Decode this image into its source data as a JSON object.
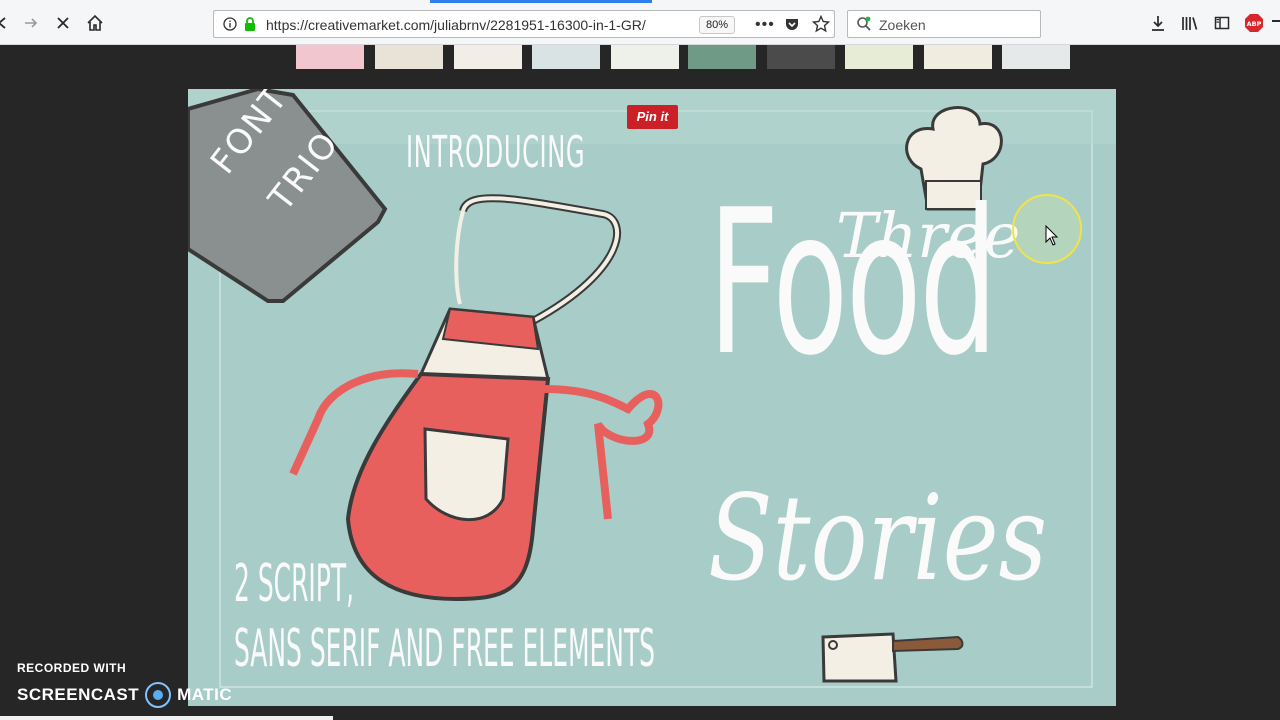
{
  "browser": {
    "url": "https://creativemarket.com/juliabrnv/2281951-16300-in-1-GR/",
    "zoom": "80%",
    "search_placeholder": "Zoeken",
    "abp_badge": "ABP"
  },
  "hero": {
    "pin_label": "Pin it",
    "tag_line1": "FONT",
    "tag_line2": "TRIO",
    "introducing": "INTRODUCING",
    "title_three": "Three",
    "title_food": "Food",
    "title_stories": "Stories",
    "bottom_line1": "2 SCRIPT,",
    "bottom_line2": "SANS SERIF AND FREE ELEMENTS"
  },
  "thumbnails": [
    {
      "color": "#f2c6cf"
    },
    {
      "color": "#e9e2d6"
    },
    {
      "color": "#f3ede8"
    },
    {
      "color": "#d9e3e3"
    },
    {
      "color": "#eef1ea"
    },
    {
      "color": "#6f9b86"
    },
    {
      "color": "#4b4b4b"
    },
    {
      "color": "#e7ecd7"
    },
    {
      "color": "#f0ede0"
    },
    {
      "color": "#e6e9ea"
    }
  ],
  "watermark": {
    "recorded_with": "RECORDED WITH",
    "brand_left": "SCREENCAST",
    "brand_right": "MATIC"
  },
  "colors": {
    "pinterest_red": "#cb2027",
    "hero_bg": "#a8cdc8",
    "apron_red": "#e8605e"
  }
}
